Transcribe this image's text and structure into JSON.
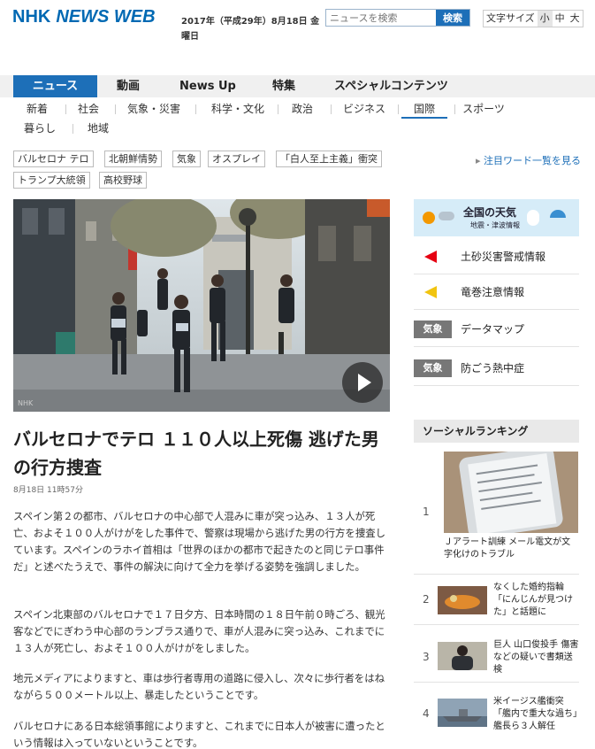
{
  "header": {
    "logo_nhk": "NHK",
    "logo_newsweb": "NEWS WEB",
    "date": "2017年（平成29年）8月18日 金曜日",
    "search_placeholder": "ニュースを検索",
    "search_button": "検索",
    "fontsize_label": "文字サイズ",
    "fontsize_small": "小",
    "fontsize_medium": "中",
    "fontsize_large": "大"
  },
  "nav": {
    "items": [
      "ニュース",
      "動画",
      "News Up",
      "特集",
      "スペシャルコンテンツ"
    ],
    "active": "ニュース"
  },
  "subnav": {
    "items": [
      "新着",
      "社会",
      "気象・災害",
      "科学・文化",
      "政治",
      "ビジネス",
      "国際",
      "スポーツ",
      "暮らし",
      "地域"
    ],
    "current": "国際"
  },
  "tags": [
    "バルセロナ テロ",
    "北朝鮮情勢",
    "気象",
    "オスプレイ",
    "「白人至上主義」衝突",
    "トランプ大統領",
    "高校野球"
  ],
  "keyword_link": "注目ワード一覧を見る",
  "article": {
    "hero_mark": "NHK",
    "title": "バルセロナでテロ １１０人以上死傷 逃げた男の行方捜査",
    "timestamp": "8月18日 11時57分",
    "paragraphs": [
      "スペイン第２の都市、バルセロナの中心部で人混みに車が突っ込み、１３人が死亡、およそ１００人がけがをした事件で、警察は現場から逃げた男の行方を捜査しています。スペインのラホイ首相は「世界のほかの都市で起きたのと同じテロ事件だ」と述べたうえで、事件の解決に向けて全力を挙げる姿勢を強調しました。",
      "スペイン北東部のバルセロナで１７日夕方、日本時間の１８日午前０時ごろ、観光客などでにぎわう中心部のランブラス通りで、車が人混みに突っ込み、これまでに１３人が死亡し、およそ１００人がけがをしました。",
      "地元メディアによりますと、車は歩行者専用の道路に侵入し、次々に歩行者をはねながら５００メートル以上、暴走したということです。",
      "バルセロナにある日本総領事館によりますと、これまでに日本人が被害に遭ったという情報は入っていないということです。"
    ]
  },
  "sidebar": {
    "weather_title": "全国の天気",
    "weather_sub": "地震・津波情報",
    "alerts": [
      "土砂災害警戒情報",
      "竜巻注意情報"
    ],
    "badge_label": "気象",
    "weather_links": [
      "データマップ",
      "防ごう熱中症"
    ],
    "ranking_title": "ソーシャルランキング",
    "ranking": [
      {
        "rank": "1",
        "text": "Ｊアラート訓練 メール電文が文字化けのトラブル"
      },
      {
        "rank": "2",
        "text": "なくした婚約指輪「にんじんが見つけた」と話題に"
      },
      {
        "rank": "3",
        "text": "巨人 山口俊投手 傷害などの疑いで書類送検"
      },
      {
        "rank": "4",
        "text": "米イージス艦衝突「艦内で重大な過ち」艦長ら３人解任"
      }
    ]
  },
  "colors": {
    "brand": "#0069b3",
    "nav_active": "#1d6fb8",
    "alert_red": "#e60012",
    "alert_yellow": "#f1c40f"
  }
}
